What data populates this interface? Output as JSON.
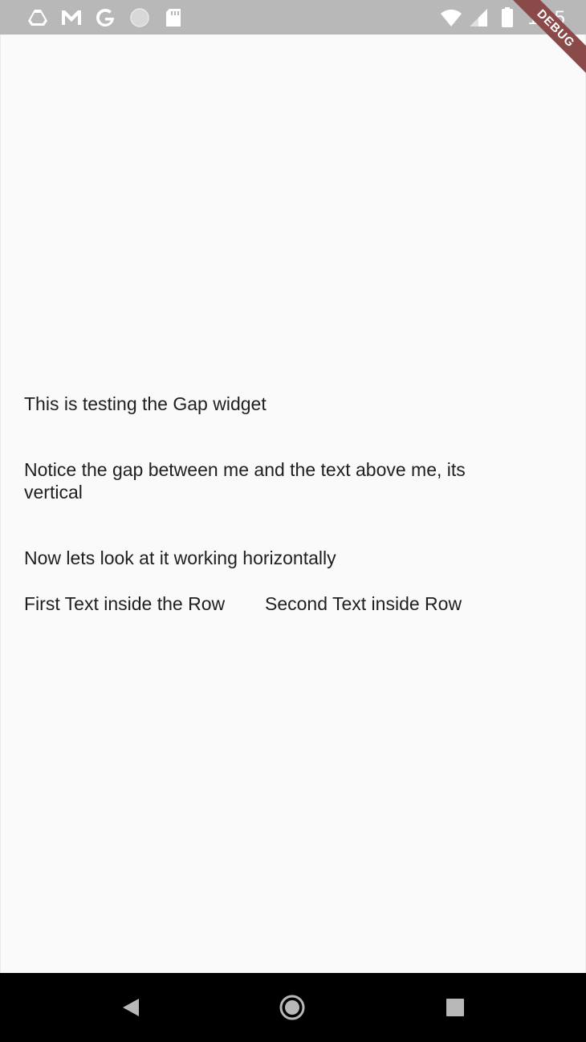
{
  "status_bar": {
    "time": "1:35",
    "icons": [
      "drive-icon",
      "gmail-icon",
      "google-icon",
      "circle-icon",
      "sd-card-icon",
      "wifi-icon",
      "signal-icon",
      "battery-icon"
    ],
    "background": "#b8b8b8"
  },
  "debug_banner": {
    "label": "DEBUG",
    "color": "#8b4a4a"
  },
  "main": {
    "line1": "This is testing the Gap widget",
    "line2": "Notice the gap between me and the text above me, its vertical",
    "line3": "Now lets look at it working horizontally",
    "row": {
      "first": "First Text inside the Row",
      "second": "Second Text inside Row"
    }
  },
  "nav_bar": {
    "buttons": [
      "back-icon",
      "home-icon",
      "recents-icon"
    ]
  }
}
